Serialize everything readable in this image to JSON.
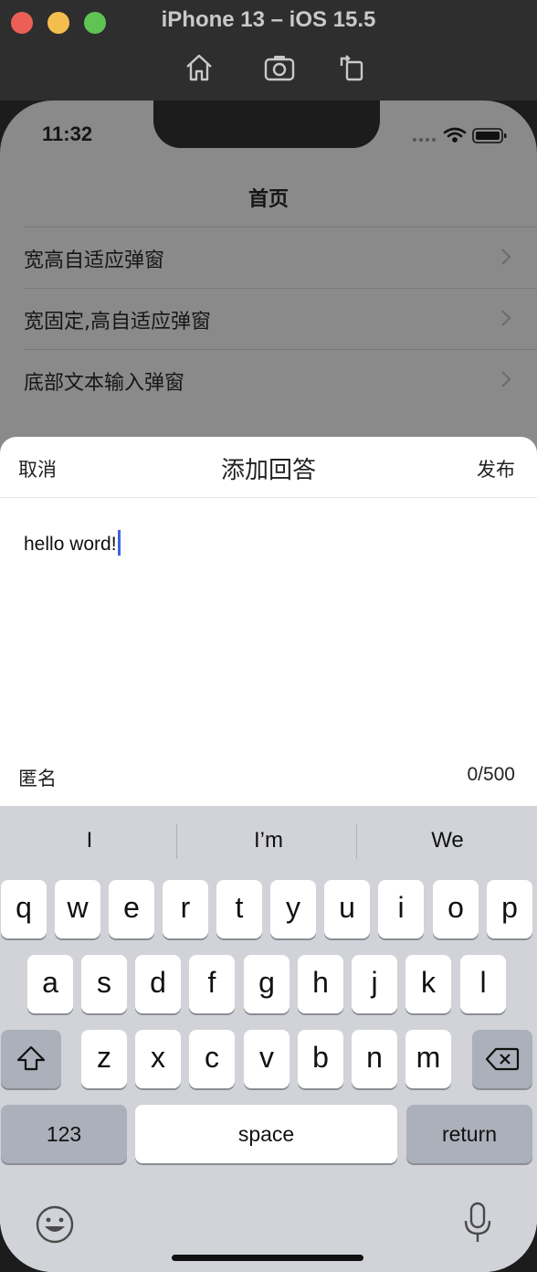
{
  "simulator": {
    "title": "iPhone 13 – iOS 15.5",
    "tools": [
      "home-icon",
      "screenshot-icon",
      "rotate-icon"
    ]
  },
  "status_bar": {
    "time": "11:32"
  },
  "nav": {
    "title": "首页"
  },
  "list_items": [
    {
      "label": "宽高自适应弹窗"
    },
    {
      "label": "宽固定,高自适应弹窗"
    },
    {
      "label": "底部文本输入弹窗"
    }
  ],
  "sheet": {
    "cancel": "取消",
    "title": "添加回答",
    "publish": "发布",
    "text": "hello word!",
    "anonymous": "匿名",
    "counter": "0/500"
  },
  "keyboard": {
    "suggestions": [
      "I",
      "I’m",
      "We"
    ],
    "row1": [
      "q",
      "w",
      "e",
      "r",
      "t",
      "y",
      "u",
      "i",
      "o",
      "p"
    ],
    "row2": [
      "a",
      "s",
      "d",
      "f",
      "g",
      "h",
      "j",
      "k",
      "l"
    ],
    "row3": [
      "z",
      "x",
      "c",
      "v",
      "b",
      "n",
      "m"
    ],
    "numbers": "123",
    "space": "space",
    "return": "return"
  },
  "colors": {
    "caret": "#3c64e0",
    "keyboard_bg": "#d1d3d9",
    "special_key": "#abb0ba"
  }
}
